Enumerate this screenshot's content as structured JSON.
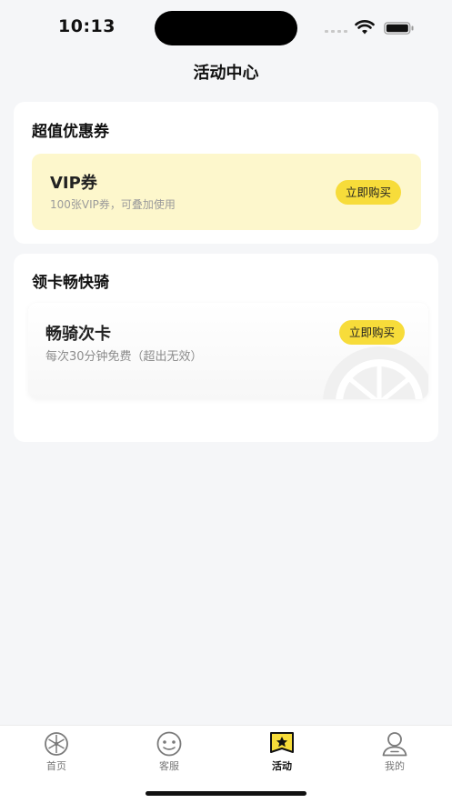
{
  "status_bar": {
    "time": "10:13"
  },
  "nav": {
    "title": "活动中心"
  },
  "coupon_section": {
    "title": "超值优惠券",
    "items": [
      {
        "name": "VIP券",
        "description": "100张VIP券，可叠加使用",
        "button": "立即购买"
      }
    ]
  },
  "ride_section": {
    "title": "领卡畅快骑",
    "items": [
      {
        "name": "畅骑次卡",
        "description": "每次30分钟免费（超出无效）",
        "button": "立即购买"
      }
    ]
  },
  "tabs": [
    {
      "label": "首页",
      "icon": "wheel-icon",
      "active": false
    },
    {
      "label": "客服",
      "icon": "service-face-icon",
      "active": false
    },
    {
      "label": "活动",
      "icon": "star-flag-icon",
      "active": true
    },
    {
      "label": "我的",
      "icon": "user-icon",
      "active": false
    }
  ],
  "colors": {
    "accent": "#f7dc3a",
    "coupon_bg": "#fdf7cc",
    "page_bg": "#f5f6f8"
  }
}
